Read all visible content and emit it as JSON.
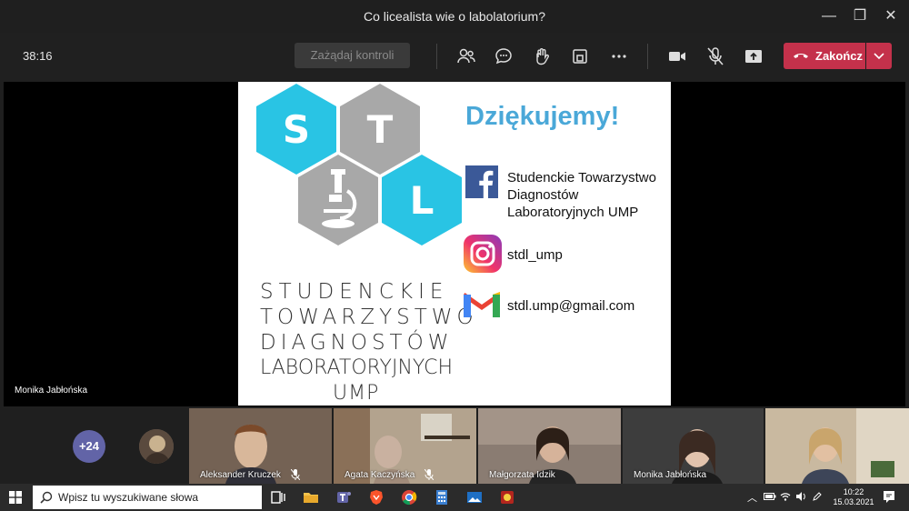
{
  "window": {
    "title": "Co licealista wie o labolatorium?",
    "minimize": "—",
    "restore": "❐",
    "close": "✕"
  },
  "toolbar": {
    "timer": "38:16",
    "request_control": "Zażądaj kontroli",
    "end_call": "Zakończ"
  },
  "presenter": {
    "name": "Monika Jabłońska"
  },
  "slide": {
    "hexagons": [
      "S",
      "T",
      "L"
    ],
    "org_lines": [
      "STUDENCKIE",
      "TOWARZYSTWO",
      "DIAGNOSTÓW",
      "LABORATORYJNYCH",
      "UMP"
    ],
    "thanks": "Dziękujemy!",
    "facebook": [
      "Studenckie Towarzystwo",
      "Diagnostów",
      "Laboratoryjnych UMP"
    ],
    "instagram": "stdl_ump",
    "email": "stdl.ump@gmail.com"
  },
  "participants": {
    "overflow_count": "+24",
    "tiles": [
      {
        "name": "Aleksander Kruczek",
        "bg": "#6b5a4c"
      },
      {
        "name": "Agata Kaczyńska",
        "bg": "#a79b88"
      },
      {
        "name": "Małgorzata Idzik",
        "bg": "#8a7c72"
      },
      {
        "name": "Monika Jabłońska",
        "bg": "#3d3d3d"
      },
      {
        "name": "",
        "bg": "#c9b9a0"
      }
    ]
  },
  "taskbar": {
    "search_placeholder": "Wpisz tu wyszukiwane słowa",
    "time": "10:22",
    "date": "15.03.2021"
  },
  "colors": {
    "accent_end": "#c4314b",
    "teal": "#29c4e4",
    "gray_hex": "#a8a8a8",
    "teams": "#6264a7"
  }
}
